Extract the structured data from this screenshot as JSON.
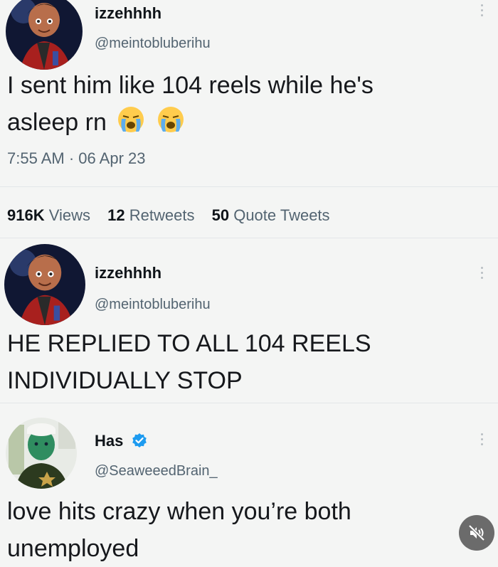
{
  "tweet1": {
    "name": "izzehhhh",
    "handle": "@meintobluberihu",
    "text_line1": "I sent him like 104 reels while he's",
    "text_line2": "asleep rn",
    "emoji": "loudly-crying-face",
    "time": "7:55 AM",
    "separator": "·",
    "date": "06 Apr 23",
    "views_count": "916K",
    "views_label": "Views",
    "retweets_count": "12",
    "retweets_label": "Retweets",
    "quotes_count": "50",
    "quotes_label": "Quote Tweets"
  },
  "tweet2": {
    "name": "izzehhhh",
    "handle": "@meintobluberihu",
    "text_line1": "HE REPLIED TO ALL 104 REELS",
    "text_line2": "INDIVIDUALLY STOP"
  },
  "tweet3": {
    "name": "Has",
    "handle": "@SeaweeedBrain_",
    "verified_icon": "verified-badge-icon",
    "text_line1": "love hits crazy when you’re both",
    "text_line2": "unemployed"
  },
  "colors": {
    "background": "#f4f5f4",
    "verified_blue": "#1d9bf0",
    "secondary_text": "#536471"
  },
  "icons": {
    "more": "more-options-icon",
    "mute": "mute-icon"
  }
}
